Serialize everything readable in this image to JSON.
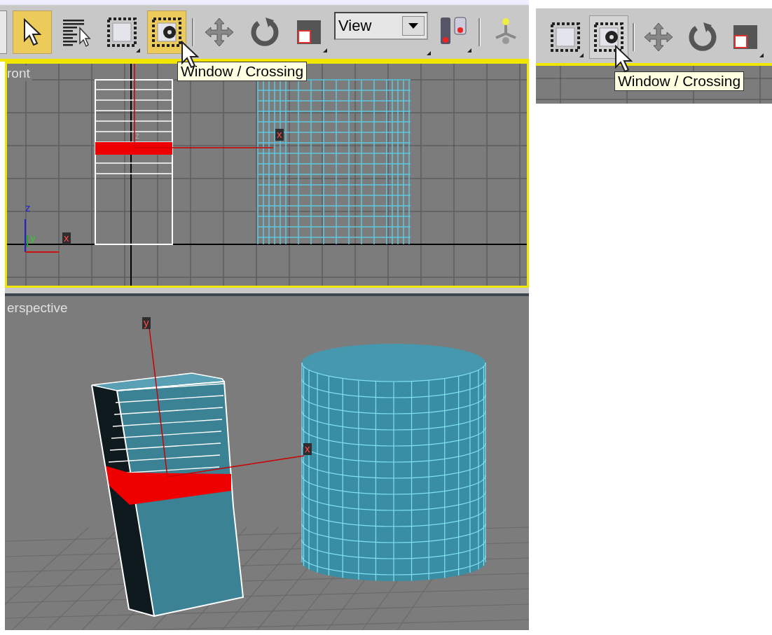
{
  "main": {
    "toolbar": {
      "items": [
        {
          "kind": "button-edge"
        },
        {
          "kind": "select",
          "selected": true
        },
        {
          "kind": "select-by-name",
          "selected": false
        },
        {
          "kind": "region",
          "selected": false
        },
        {
          "kind": "window-crossing",
          "selected": true
        },
        {
          "kind": "separator"
        },
        {
          "kind": "move",
          "selected": false
        },
        {
          "kind": "rotate",
          "selected": false
        },
        {
          "kind": "scale",
          "selected": false
        },
        {
          "kind": "dropdown",
          "value": "View"
        },
        {
          "kind": "pivot",
          "selected": false
        },
        {
          "kind": "separator"
        },
        {
          "kind": "constraint",
          "selected": false
        }
      ],
      "tooltip": "Window / Crossing"
    },
    "viewports": [
      {
        "kind": "front",
        "label": "ront",
        "active": true,
        "axis_labels": [
          "z",
          "x",
          "z",
          "y",
          "x"
        ]
      },
      {
        "kind": "perspective",
        "label": "erspective",
        "active": false,
        "axis_labels": [
          "y",
          "x"
        ]
      }
    ]
  },
  "inset": {
    "toolbar": {
      "items": [
        {
          "kind": "region",
          "hovered": false
        },
        {
          "kind": "window-crossing",
          "hovered": true
        },
        {
          "kind": "separator"
        },
        {
          "kind": "move",
          "hovered": false
        },
        {
          "kind": "rotate",
          "hovered": false
        },
        {
          "kind": "scale",
          "hovered": false
        }
      ],
      "tooltip": "Window / Crossing"
    }
  }
}
